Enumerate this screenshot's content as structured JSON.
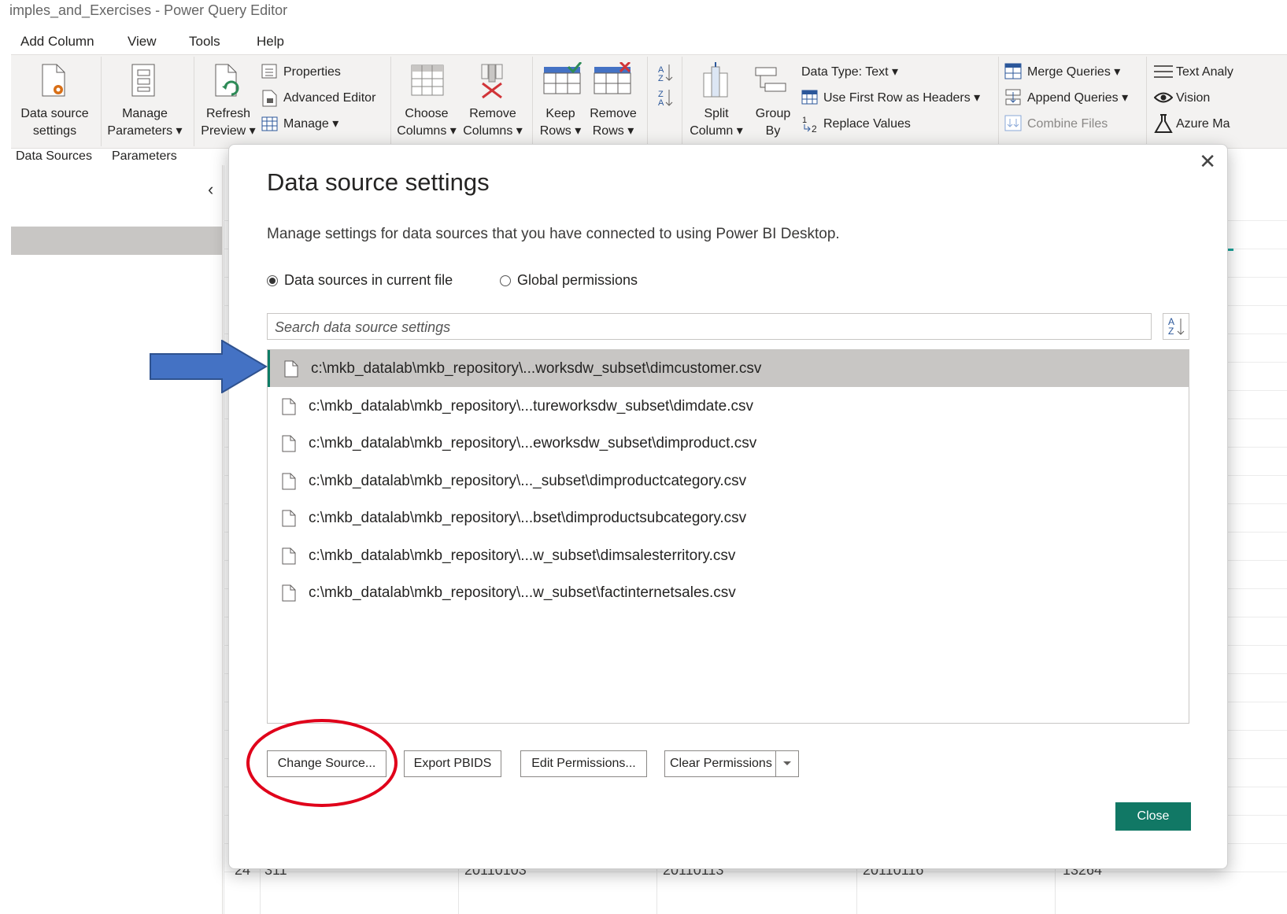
{
  "window": {
    "title": "imples_and_Exercises - Power Query Editor"
  },
  "menu": [
    "Add Column",
    "View",
    "Tools",
    "Help"
  ],
  "ribbon": {
    "data_source_settings": [
      "Data source",
      "settings"
    ],
    "manage_parameters": [
      "Manage",
      "Parameters ▾"
    ],
    "refresh_preview": [
      "Refresh",
      "Preview ▾"
    ],
    "properties": "Properties",
    "advanced_editor": "Advanced Editor",
    "manage": "Manage ▾",
    "choose_columns": [
      "Choose",
      "Columns ▾"
    ],
    "remove_columns": [
      "Remove",
      "Columns ▾"
    ],
    "keep_rows": [
      "Keep",
      "Rows ▾"
    ],
    "remove_rows": [
      "Remove",
      "Rows ▾"
    ],
    "split_column": [
      "Split",
      "Column ▾"
    ],
    "group_by": [
      "Group",
      "By"
    ],
    "data_type": "Data Type: Text ▾",
    "use_first_row": "Use First Row as Headers ▾",
    "replace_values": "Replace Values",
    "merge_queries": "Merge Queries ▾",
    "append_queries": "Append Queries ▾",
    "combine_files": "Combine Files",
    "text_analytics": "Text Analy",
    "vision": "Vision",
    "azure_ml": "Azure Ma",
    "groups": {
      "data_sources": "Data Sources",
      "parameters": "Parameters"
    }
  },
  "grid_partial": {
    "row_num": "24",
    "c1": "311",
    "c2": "20110103",
    "c3": "20110113",
    "c4": "20110116",
    "c5": "13264"
  },
  "dialog": {
    "title": "Data source settings",
    "description": "Manage settings for data sources that you have connected to using Power BI Desktop.",
    "radio_current": "Data sources in current file",
    "radio_global": "Global permissions",
    "search_placeholder": "Search data source settings",
    "sources": [
      "c:\\mkb_datalab\\mkb_repository\\...worksdw_subset\\dimcustomer.csv",
      "c:\\mkb_datalab\\mkb_repository\\...tureworksdw_subset\\dimdate.csv",
      "c:\\mkb_datalab\\mkb_repository\\...eworksdw_subset\\dimproduct.csv",
      "c:\\mkb_datalab\\mkb_repository\\..._subset\\dimproductcategory.csv",
      "c:\\mkb_datalab\\mkb_repository\\...bset\\dimproductsubcategory.csv",
      "c:\\mkb_datalab\\mkb_repository\\...w_subset\\dimsalesterritory.csv",
      "c:\\mkb_datalab\\mkb_repository\\...w_subset\\factinternetsales.csv"
    ],
    "buttons": {
      "change_source": "Change Source...",
      "export_pbids": "Export PBIDS",
      "edit_permissions": "Edit Permissions...",
      "clear_permissions": "Clear Permissions",
      "close": "Close"
    }
  },
  "colors": {
    "accent": "#117865",
    "annotation_arrow": "#4472c4",
    "annotation_circle": "#e0001a"
  }
}
